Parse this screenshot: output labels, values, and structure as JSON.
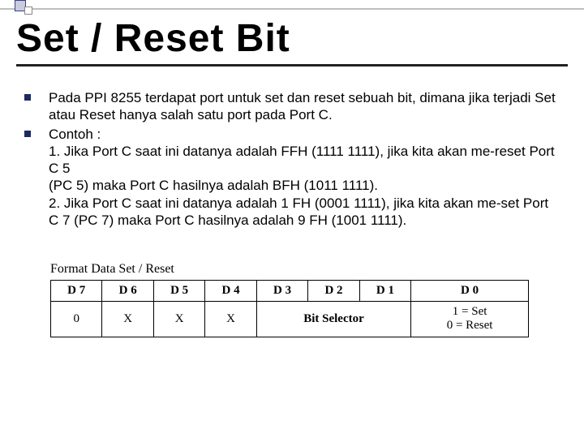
{
  "title": "Set / Reset Bit",
  "bullets": [
    {
      "text": "Pada PPI 8255 terdapat port untuk set dan reset sebuah bit, dimana jika terjadi Set atau Reset hanya salah satu port pada Port C."
    },
    {
      "text": "Contoh :",
      "lines": [
        "1. Jika Port C saat ini datanya adalah FFH (1111 1111), jika kita akan me-reset Port C 5",
        "(PC 5) maka Port C hasilnya adalah BFH (1011 1111).",
        "2. Jika Port C saat ini datanya adalah 1 FH (0001 1111), jika kita akan me-set Port C 7 (PC 7) maka Port C hasilnya adalah 9 FH (1001 1111)."
      ]
    }
  ],
  "table": {
    "caption": "Format Data Set / Reset",
    "headers": [
      "D 7",
      "D 6",
      "D 5",
      "D 4",
      "D 3",
      "D 2",
      "D 1",
      "D 0"
    ],
    "row": [
      "0",
      "X",
      "X",
      "X",
      "Bit Selector",
      "1 = Set\n0 = Reset"
    ]
  }
}
